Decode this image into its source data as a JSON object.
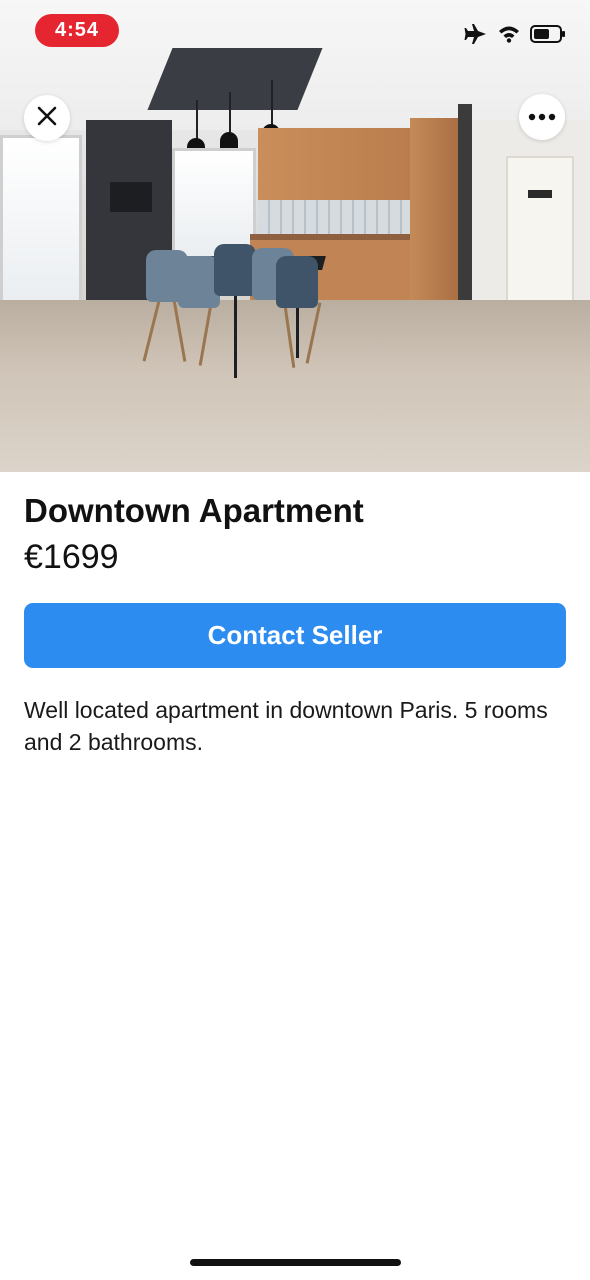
{
  "status_bar": {
    "time": "4:54",
    "icons": [
      "airplane-icon",
      "wifi-icon",
      "battery-icon"
    ]
  },
  "hero_image": {
    "subject": "kitchen-dining-photo"
  },
  "toolbar": {
    "close_icon": "close-icon",
    "more_icon": "more-options-icon"
  },
  "listing": {
    "title": "Downtown Apartment",
    "price": "€1699",
    "contact_label": "Contact Seller",
    "description": "Well located apartment in downtown Paris. 5 rooms and 2 bathrooms."
  },
  "colors": {
    "accent": "#2d8cf0",
    "recording_pill": "#e5252f"
  }
}
